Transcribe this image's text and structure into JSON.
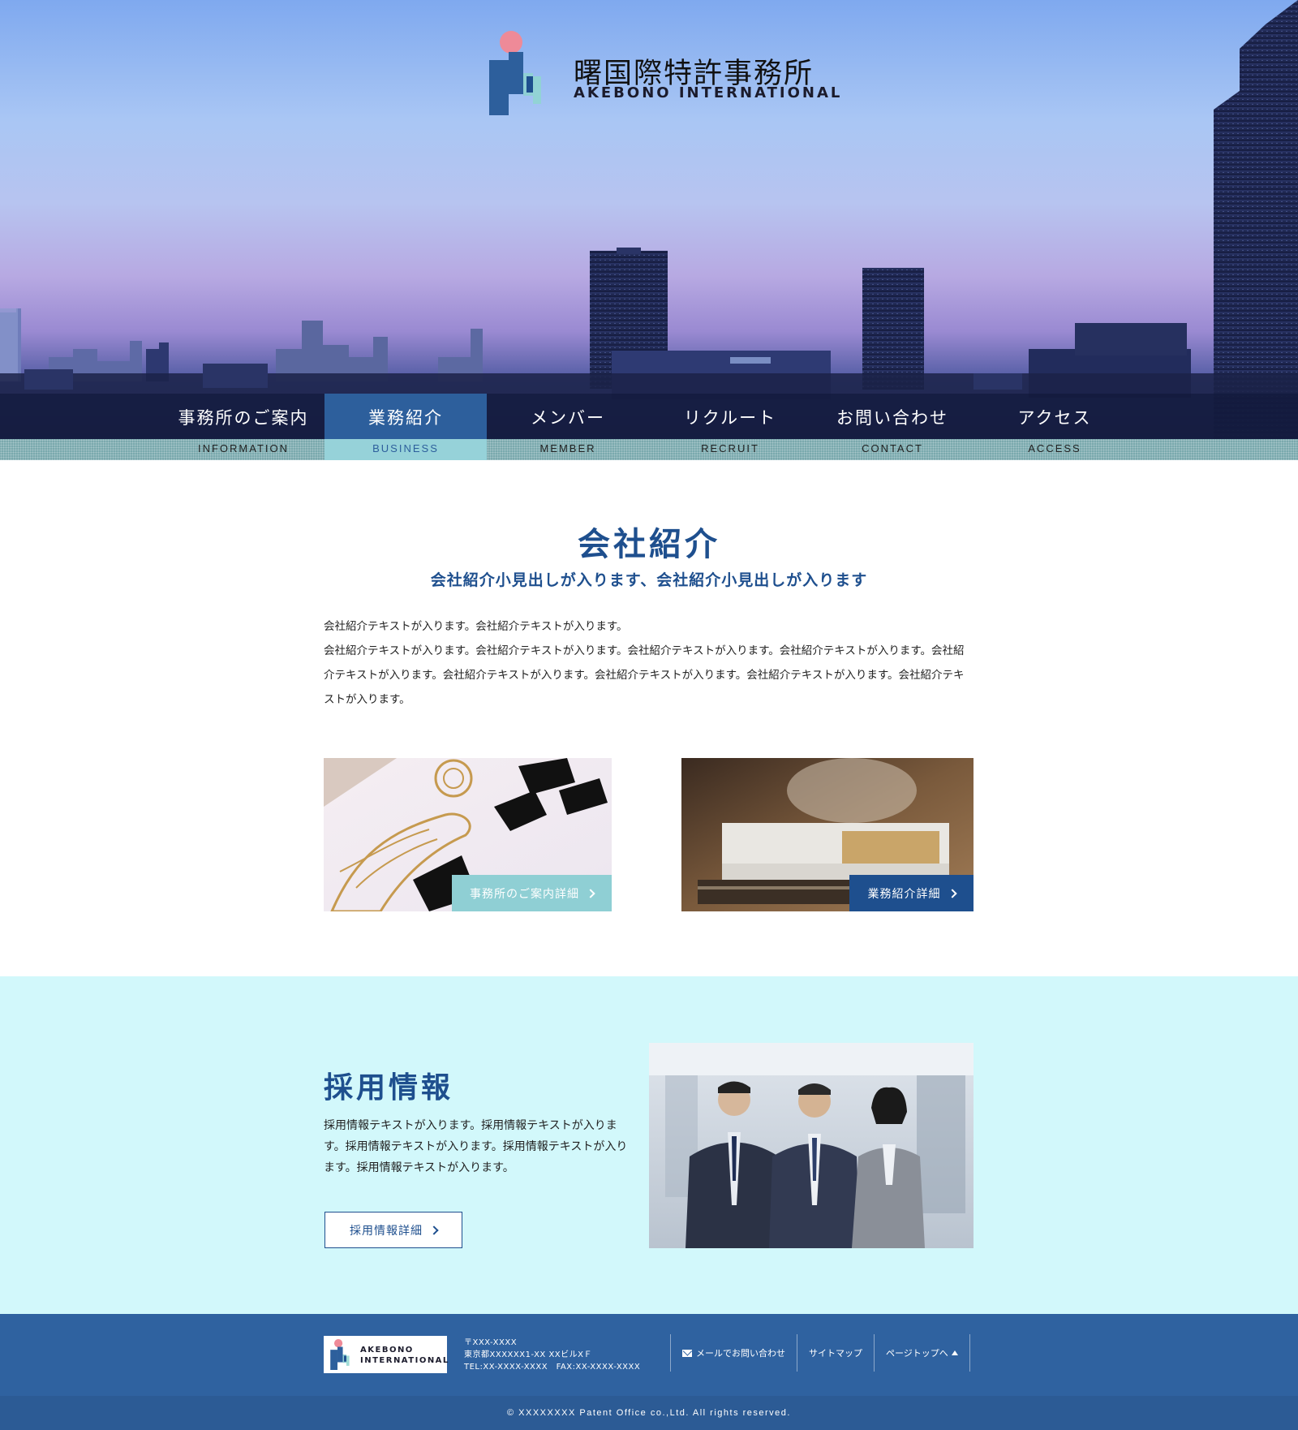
{
  "brand": {
    "name_jp": "曙国際特許事務所",
    "name_en": "AKEBONO INTERNATIONAL",
    "footer_name_line1": "AKEBONO",
    "footer_name_line2": "INTERNATIONAL"
  },
  "nav": {
    "items": [
      {
        "label_jp": "事務所のご案内",
        "label_en": "INFORMATION",
        "active": false
      },
      {
        "label_jp": "業務紹介",
        "label_en": "BUSINESS",
        "active": true
      },
      {
        "label_jp": "メンバー",
        "label_en": "MEMBER",
        "active": false
      },
      {
        "label_jp": "リクルート",
        "label_en": "RECRUIT",
        "active": false
      },
      {
        "label_jp": "お問い合わせ",
        "label_en": "CONTACT",
        "active": false
      },
      {
        "label_jp": "アクセス",
        "label_en": "ACCESS",
        "active": false
      }
    ]
  },
  "company": {
    "title": "会社紹介",
    "subtitle": "会社紹介小見出しが入ります、会社紹介小見出しが入ります",
    "paragraph1": "会社紹介テキストが入ります。会社紹介テキストが入ります。",
    "paragraph2": "会社紹介テキストが入ります。会社紹介テキストが入ります。会社紹介テキストが入ります。会社紹介テキストが入ります。会社紹介テキストが入ります。会社紹介テキストが入ります。会社紹介テキストが入ります。会社紹介テキストが入ります。会社紹介テキストが入ります。",
    "cards": [
      {
        "button_label": "事務所のご案内詳細",
        "image": "certificate-photo"
      },
      {
        "button_label": "業務紹介詳細",
        "image": "documents-photo"
      }
    ]
  },
  "recruit": {
    "title": "採用情報",
    "text": "採用情報テキストが入ります。採用情報テキストが入ります。採用情報テキストが入ります。採用情報テキストが入ります。採用情報テキストが入ります。",
    "button_label": "採用情報詳細",
    "image": "business-team-photo"
  },
  "footer": {
    "postal": "〒XXX-XXXX",
    "address": "東京都XXXXXX1-XX XXビルXＦ",
    "phone_fax": "TEL:XX-XXXX-XXXX　FAX:XX-XXXX-XXXX",
    "links": {
      "contact": "メールでお問い合わせ",
      "sitemap": "サイトマップ",
      "pagetop": "ページトップへ"
    },
    "copyright": "© XXXXXXXX Patent Office co.,Ltd. All rights reserved."
  },
  "colors": {
    "brand_blue": "#1e4f8e",
    "accent_teal": "#8fcfd4",
    "recruit_bg": "#d2f8fb",
    "footer_blue": "#2f62a0"
  }
}
